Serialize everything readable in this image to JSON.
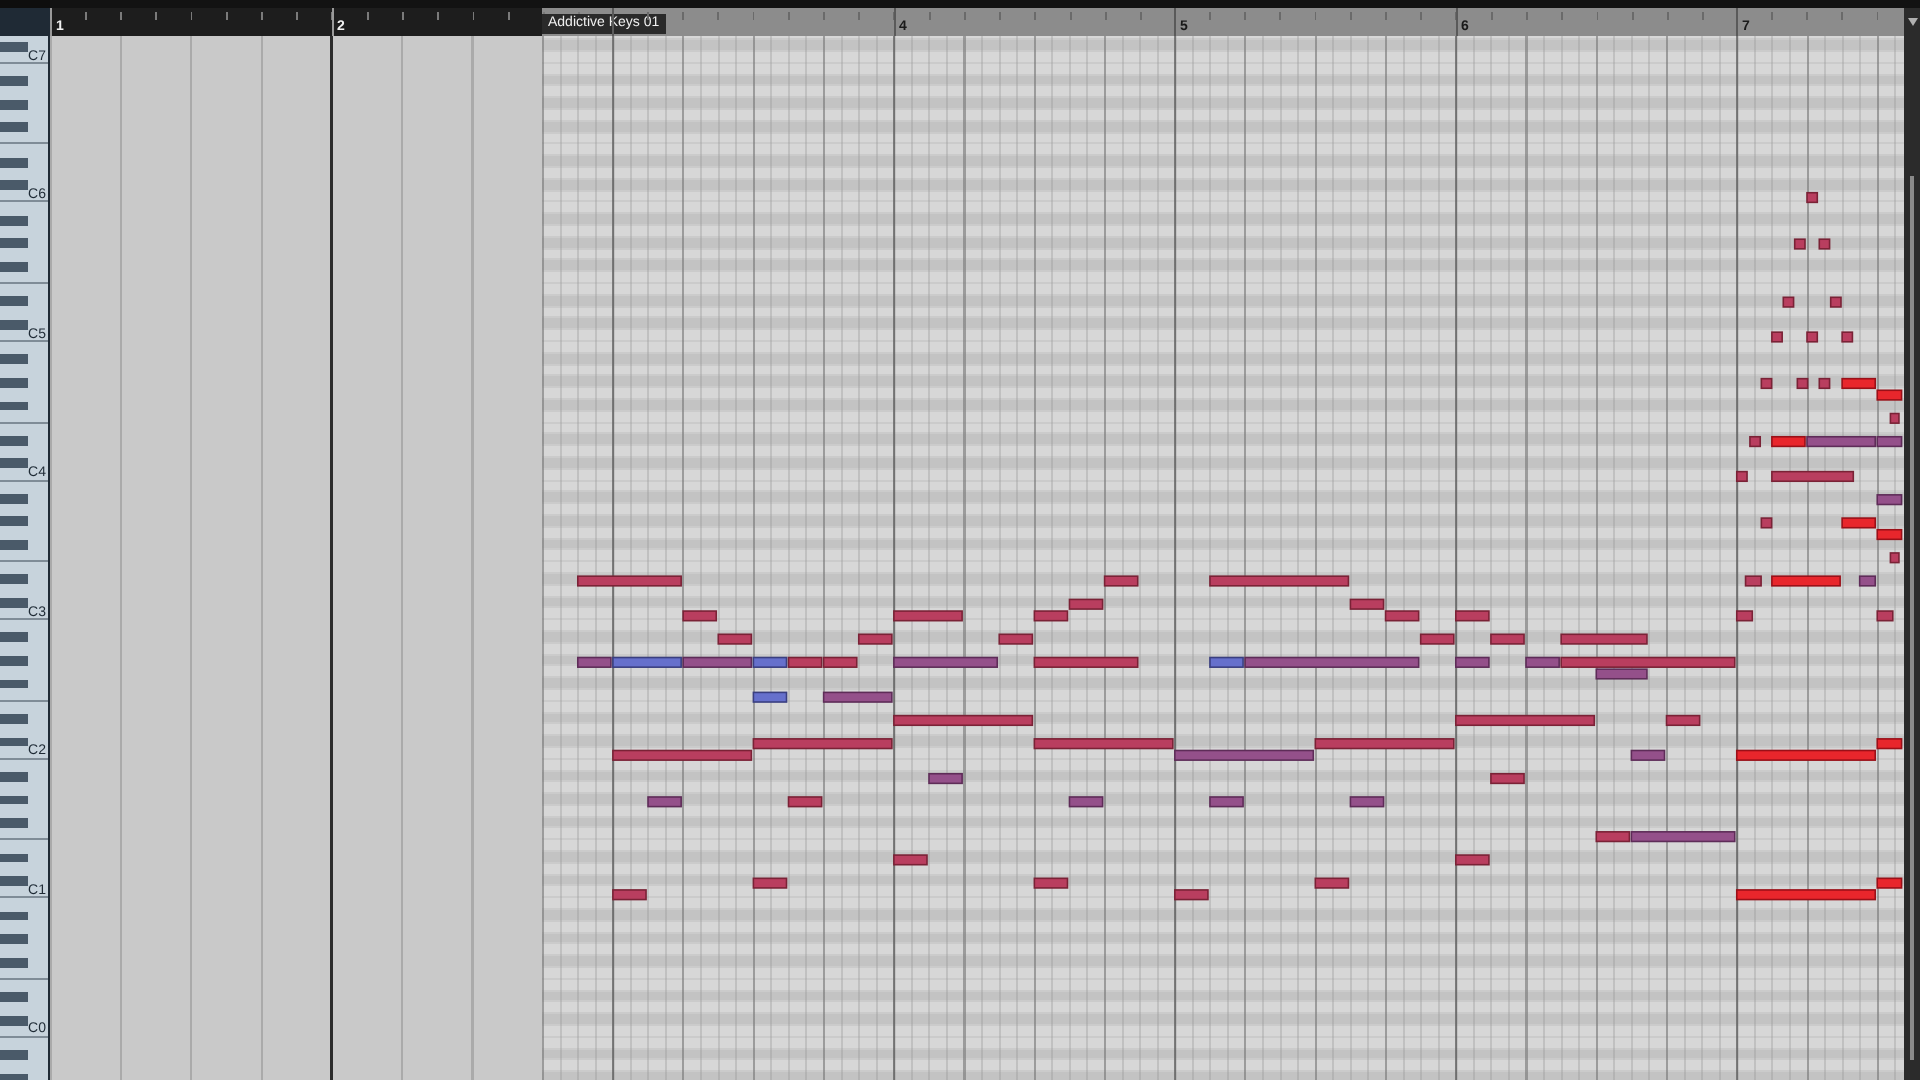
{
  "ruler": {
    "bars": [
      "1",
      "2",
      "4",
      "5",
      "6",
      "7"
    ]
  },
  "part": {
    "name": "Addictive Keys 01"
  },
  "keyboard": {
    "octave_labels": [
      "C7",
      "C6",
      "C5",
      "C4",
      "C3",
      "C2",
      "C1",
      "C0"
    ]
  }
}
